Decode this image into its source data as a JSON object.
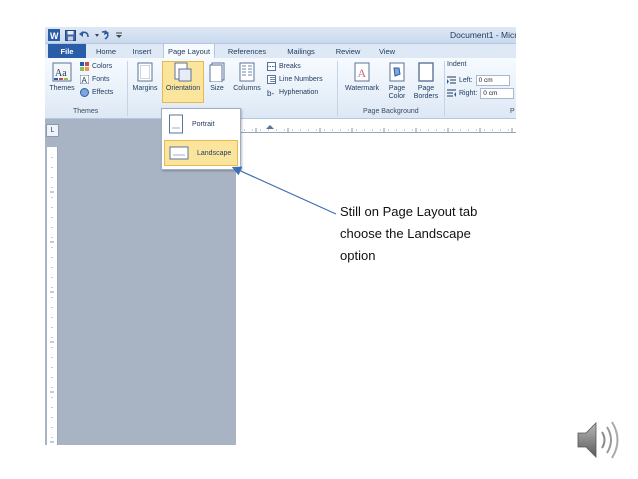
{
  "window": {
    "title": "Document1 - Micr"
  },
  "tabs": [
    {
      "label": "File"
    },
    {
      "label": "Home"
    },
    {
      "label": "Insert"
    },
    {
      "label": "Page Layout"
    },
    {
      "label": "References"
    },
    {
      "label": "Mailings"
    },
    {
      "label": "Review"
    },
    {
      "label": "View"
    }
  ],
  "ribbon": {
    "themes": {
      "themes_label": "Themes",
      "colors": "Colors",
      "fonts": "Fonts",
      "effects": "Effects",
      "group": "Themes"
    },
    "page_setup": {
      "margins": "Margins",
      "orientation": "Orientation",
      "size": "Size",
      "columns": "Columns",
      "breaks": "Breaks",
      "line_numbers": "Line Numbers",
      "hyphenation": "Hyphenation",
      "group_tail": "p"
    },
    "page_background": {
      "watermark": "Watermark",
      "page_color_1": "Page",
      "page_color_2": "Color",
      "page_borders_1": "Page",
      "page_borders_2": "Borders",
      "group": "Page Background"
    },
    "paragraph": {
      "indent": "Indent",
      "left_label": "Left:",
      "left_value": "0 cm",
      "right_label": "Right:",
      "right_value": "0 cm",
      "group_tail": "P"
    }
  },
  "orientation_menu": {
    "items": [
      {
        "label": "Portrait"
      },
      {
        "label": "Landscape"
      }
    ],
    "selected": "Landscape"
  },
  "callout": {
    "line1": "Still on Page Layout tab",
    "line2": "choose the Landscape",
    "line3": "option"
  },
  "colors": {
    "accent": "#2a5da8",
    "highlight": "#fbe59d",
    "arrow": "#3c6fb5"
  },
  "icons": [
    "word-app-icon",
    "save-icon",
    "undo-icon",
    "redo-icon",
    "speaker-icon"
  ]
}
